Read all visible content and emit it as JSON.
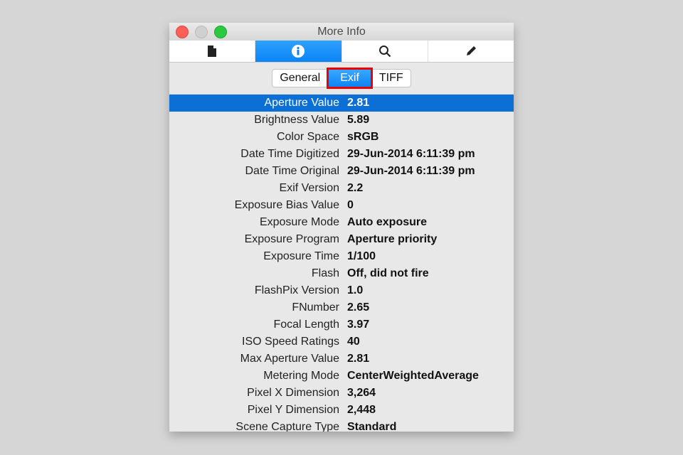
{
  "window": {
    "title": "More Info"
  },
  "toolbar": {
    "tabs": [
      {
        "icon": "document-icon"
      },
      {
        "icon": "info-icon"
      },
      {
        "icon": "search-icon"
      },
      {
        "icon": "pencil-icon"
      }
    ],
    "active": 1
  },
  "segments": {
    "general": "General",
    "exif": "Exif",
    "tiff": "TIFF"
  },
  "rows": [
    {
      "label": "Aperture Value",
      "value": "2.81"
    },
    {
      "label": "Brightness Value",
      "value": "5.89"
    },
    {
      "label": "Color Space",
      "value": "sRGB"
    },
    {
      "label": "Date Time Digitized",
      "value": "29-Jun-2014 6:11:39 pm"
    },
    {
      "label": "Date Time Original",
      "value": "29-Jun-2014 6:11:39 pm"
    },
    {
      "label": "Exif Version",
      "value": "2.2"
    },
    {
      "label": "Exposure Bias Value",
      "value": "0"
    },
    {
      "label": "Exposure Mode",
      "value": "Auto exposure"
    },
    {
      "label": "Exposure Program",
      "value": "Aperture priority"
    },
    {
      "label": "Exposure Time",
      "value": "1/100"
    },
    {
      "label": "Flash",
      "value": "Off, did not fire"
    },
    {
      "label": "FlashPix Version",
      "value": "1.0"
    },
    {
      "label": "FNumber",
      "value": "2.65"
    },
    {
      "label": "Focal Length",
      "value": "3.97"
    },
    {
      "label": "ISO Speed Ratings",
      "value": "40"
    },
    {
      "label": "Max Aperture Value",
      "value": "2.81"
    },
    {
      "label": "Metering Mode",
      "value": "CenterWeightedAverage"
    },
    {
      "label": "Pixel X Dimension",
      "value": "3,264"
    },
    {
      "label": "Pixel Y Dimension",
      "value": "2,448"
    },
    {
      "label": "Scene Capture Type",
      "value": "Standard"
    }
  ],
  "colors": {
    "accent": "#0b6fd6",
    "highlight": "#e00000"
  }
}
